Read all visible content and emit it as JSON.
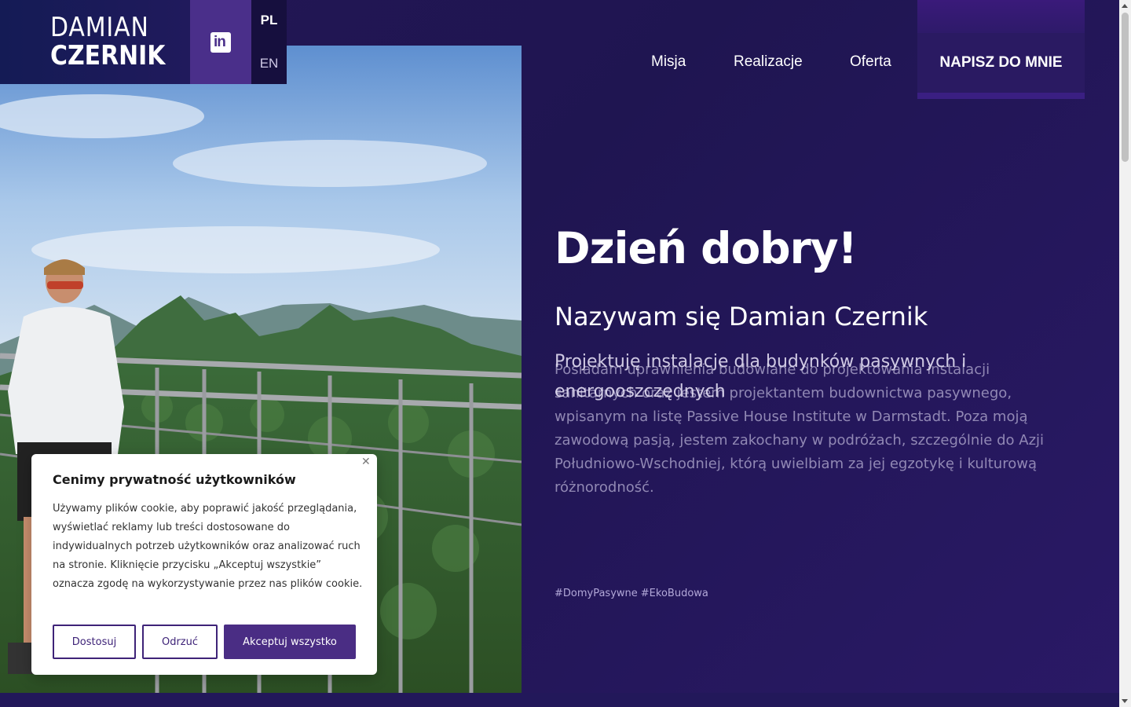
{
  "header": {
    "logo_line1": "DAMIAN",
    "logo_line2": "CZERNIK",
    "linkedin_icon": "linkedin-icon",
    "languages": [
      "PL",
      "EN"
    ],
    "active_language": "PL"
  },
  "nav": {
    "items": [
      "Misja",
      "Realizacje",
      "Oferta"
    ],
    "cta_label": "NAPISZ DO MNIE"
  },
  "hero": {
    "title": "Dzień dobry!",
    "name": "Nazywam się Damian Czernik",
    "subtitle": "Projektuję instalacje dla budynków pasywnych i energooszczędnych",
    "paragraph": "Posiadam uprawnienia budowlane do projektowania instalacji sanitarnych oraz jestem projektantem budownictwa pasywnego, wpisanym na listę Passive House Institute w Darmstadt. Poza moją zawodową pasją, jestem zakochany w podróżach, szczególnie do Azji Południowo-Wschodniej, którą uwielbiam za jej egzotykę i kulturową różnorodność.",
    "tags": [
      "#DomyPasywne",
      "#EkoBudowa"
    ]
  },
  "cookie": {
    "title": "Cenimy prywatność użytkowników",
    "text": "Używamy plików cookie, aby poprawić jakość przeglądania, wyświetlać reklamy lub treści dostosowane do indywidualnych potrzeb użytkowników oraz analizować ruch na stronie. Kliknięcie przycisku „Akceptuj wszystkie” oznacza zgodę na wykorzystywanie przez nas plików cookie.",
    "btn_customize": "Dostosuj",
    "btn_reject": "Odrzuć",
    "btn_accept": "Akceptuj wszystko",
    "close_icon": "close-icon"
  },
  "colors": {
    "background": "#231655",
    "accent": "#4a2d84",
    "linkedin_block": "#4a2f8a"
  }
}
